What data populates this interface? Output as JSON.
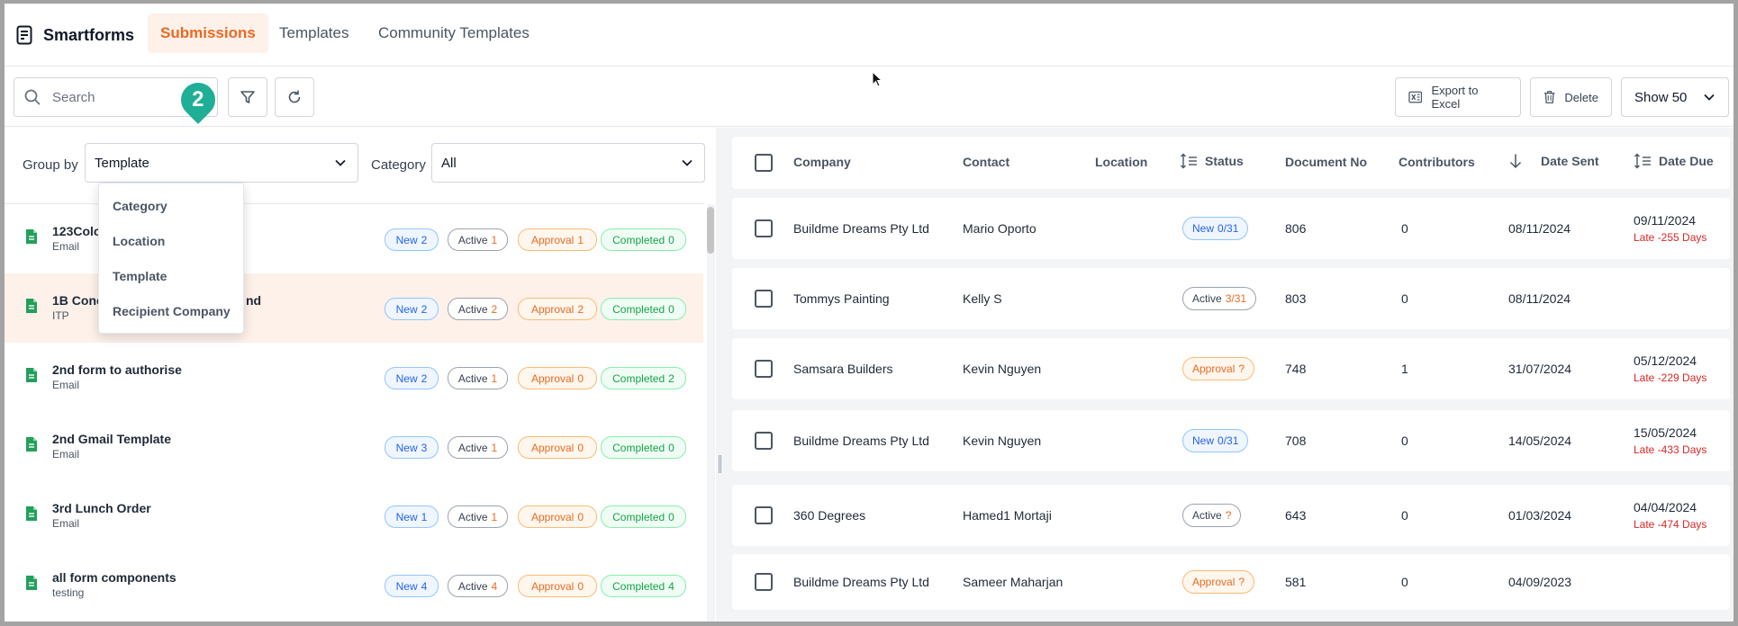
{
  "app": {
    "title": "Smartforms"
  },
  "nav": {
    "tabs": [
      "Submissions",
      "Templates",
      "Community Templates"
    ]
  },
  "toolbar": {
    "search_placeholder": "Search",
    "export_label": "Export to Excel",
    "delete_label": "Delete",
    "show_label": "Show 50"
  },
  "tour_marker": "2",
  "filters": {
    "group_by_label": "Group by",
    "group_by_value": "Template",
    "category_label": "Category",
    "category_value": "All"
  },
  "group_by_options": [
    "Category",
    "Location",
    "Template",
    "Recipient Company"
  ],
  "template_list": [
    {
      "name": "123Colo",
      "sub": "Email",
      "new": "2",
      "active": "1",
      "approval": "1",
      "completed": "0"
    },
    {
      "name": "1B Conc",
      "name_tail": "nd",
      "sub": "ITP",
      "new": "2",
      "active": "2",
      "approval": "2",
      "completed": "0"
    },
    {
      "name": "2nd form to authorise",
      "sub": "Email",
      "new": "2",
      "active": "1",
      "approval": "0",
      "completed": "2"
    },
    {
      "name": "2nd Gmail Template",
      "sub": "Email",
      "new": "3",
      "active": "1",
      "approval": "0",
      "completed": "0"
    },
    {
      "name": "3rd Lunch Order",
      "sub": "Email",
      "new": "1",
      "active": "1",
      "approval": "0",
      "completed": "0"
    },
    {
      "name": "all form components",
      "sub": "testing",
      "new": "4",
      "active": "4",
      "approval": "0",
      "completed": "4"
    }
  ],
  "pill_labels": {
    "new": "New",
    "active": "Active",
    "approval": "Approval",
    "completed": "Completed"
  },
  "table": {
    "headers": [
      "Company",
      "Contact",
      "Location",
      "Status",
      "Document No",
      "Contributors",
      "Date Sent",
      "Date Due"
    ],
    "rows": [
      {
        "company": "Buildme Dreams Pty Ltd",
        "contact": "Mario Oporto",
        "location": "",
        "status": "New",
        "status_count": "0/31",
        "status_kind": "new",
        "doc_no": "806",
        "contributors": "0",
        "date_sent": "08/11/2024",
        "date_due": "09/11/2024",
        "late": "Late -255 Days"
      },
      {
        "company": "Tommys Painting",
        "contact": "Kelly S",
        "location": "",
        "status": "Active",
        "status_count": "3/31",
        "status_kind": "active",
        "doc_no": "803",
        "contributors": "0",
        "date_sent": "08/11/2024",
        "date_due": "",
        "late": ""
      },
      {
        "company": "Samsara Builders",
        "contact": "Kevin Nguyen",
        "location": "",
        "status": "Approval",
        "status_count": "?",
        "status_kind": "approval",
        "doc_no": "748",
        "contributors": "1",
        "date_sent": "31/07/2024",
        "date_due": "05/12/2024",
        "late": "Late -229 Days"
      },
      {
        "company": "Buildme Dreams Pty Ltd",
        "contact": "Kevin Nguyen",
        "location": "",
        "status": "New",
        "status_count": "0/31",
        "status_kind": "new",
        "doc_no": "708",
        "contributors": "0",
        "date_sent": "14/05/2024",
        "date_due": "15/05/2024",
        "late": "Late -433 Days"
      },
      {
        "company": "360 Degrees",
        "contact": "Hamed1 Mortaji",
        "location": "",
        "status": "Active",
        "status_count": "?",
        "status_kind": "active",
        "doc_no": "643",
        "contributors": "0",
        "date_sent": "01/03/2024",
        "date_due": "04/04/2024",
        "late": "Late -474 Days"
      },
      {
        "company": "Buildme Dreams Pty Ltd",
        "contact": "Sameer Maharjan",
        "location": "",
        "status": "Approval",
        "status_count": "?",
        "status_kind": "approval",
        "doc_no": "581",
        "contributors": "0",
        "date_sent": "04/09/2023",
        "date_due": "",
        "late": ""
      }
    ]
  },
  "colors": {
    "accent": "#ea6a23",
    "tour_marker": "#1fae96",
    "late": "#dc2626"
  }
}
